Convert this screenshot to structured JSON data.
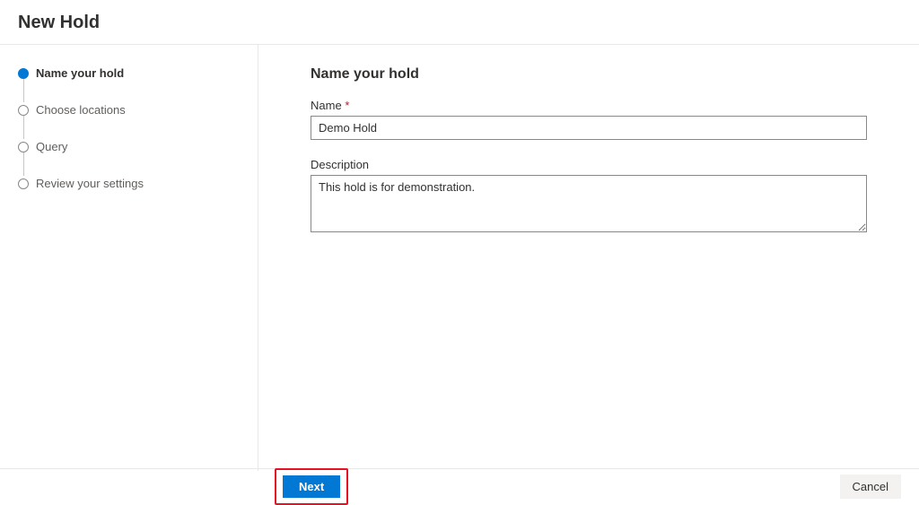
{
  "header": {
    "title": "New Hold"
  },
  "sidebar": {
    "steps": [
      {
        "label": "Name your hold",
        "active": true
      },
      {
        "label": "Choose locations",
        "active": false
      },
      {
        "label": "Query",
        "active": false
      },
      {
        "label": "Review your settings",
        "active": false
      }
    ]
  },
  "main": {
    "heading": "Name your hold",
    "name_label": "Name",
    "name_required": "*",
    "name_value": "Demo Hold",
    "description_label": "Description",
    "description_value": "This hold is for demonstration."
  },
  "footer": {
    "next_label": "Next",
    "cancel_label": "Cancel"
  }
}
